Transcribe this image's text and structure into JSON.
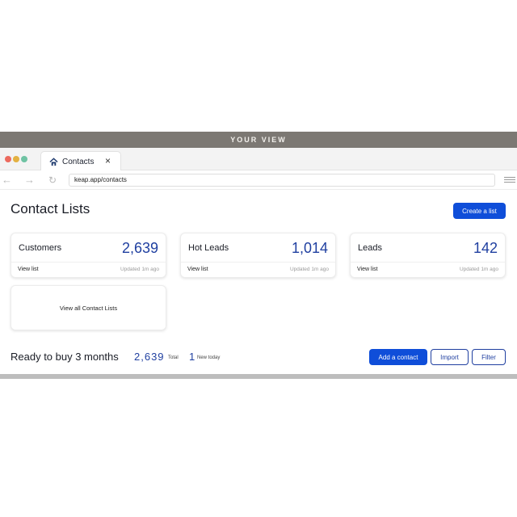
{
  "banner": {
    "label": "YOUR VIEW"
  },
  "browser": {
    "tab": {
      "title": "Contacts",
      "close_glyph": "×",
      "icon": "home-icon"
    },
    "address": {
      "url": "keap.app/contacts"
    },
    "nav": {
      "back": "←",
      "forward": "→",
      "reload": "↻"
    }
  },
  "page": {
    "title": "Contact Lists",
    "create_button": "Create a list",
    "cards": [
      {
        "name": "Customers",
        "count": "2,639",
        "view_label": "View list",
        "updated": "Updated 1m ago"
      },
      {
        "name": "Hot Leads",
        "count": "1,014",
        "view_label": "View list",
        "updated": "Updated 1m ago"
      },
      {
        "name": "Leads",
        "count": "142",
        "view_label": "View list",
        "updated": "Updated 1m ago"
      }
    ],
    "view_all_label": "View all Contact Lists",
    "list_summary": {
      "title": "Ready to buy 3 months",
      "total_count": "2,639",
      "total_label": "Total",
      "new_count": "1",
      "new_label": "New today"
    },
    "actions": {
      "add_contact": "Add a contact",
      "import": "Import",
      "filter": "Filter"
    }
  },
  "colors": {
    "primary": "#0f4ed9",
    "count_blue": "#1f3fa0",
    "banner_bg": "#7c7873"
  }
}
